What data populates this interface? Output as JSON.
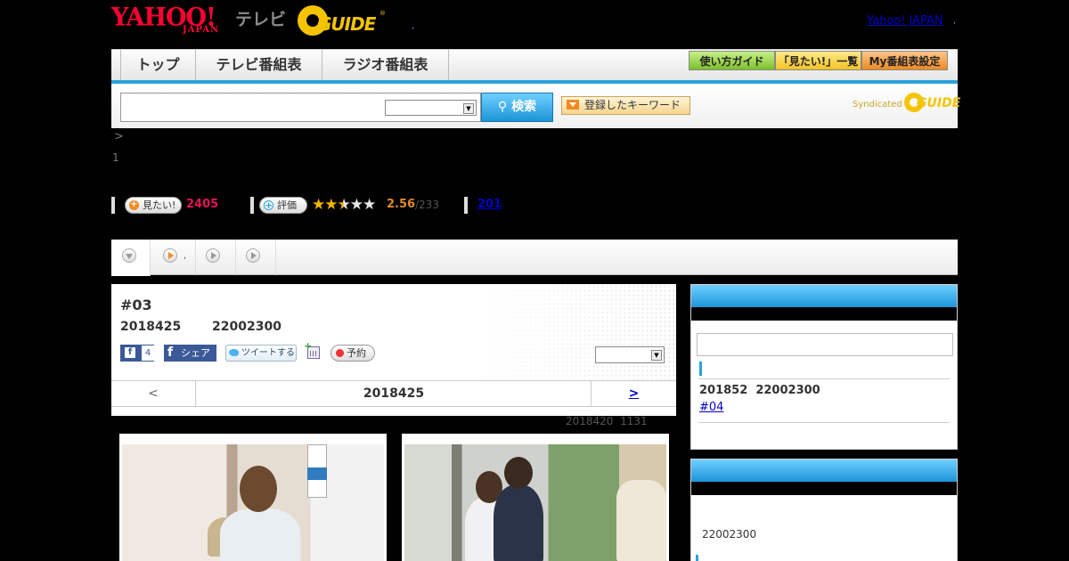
{
  "header": {
    "logo_yahoo_top": "YAHOO!",
    "logo_yahoo_bottom": "JAPAN",
    "logo_tv": "テレビ",
    "logo_gguide": "GUIDE",
    "logo_gguide_reg": "®",
    "separator": ",",
    "yahoo_japan_link": "Yahoo! JAPAN",
    "yahoo_japan_link_sep": ","
  },
  "nav": {
    "tabs": [
      {
        "label": "トップ"
      },
      {
        "label": "テレビ番組表"
      },
      {
        "label": "ラジオ番組表"
      }
    ],
    "buttons": {
      "guide": "使い方ガイド",
      "mitai_list": "「見たい!」一覧",
      "my_schedule": "My番組表設定"
    },
    "accent_color": "#2aa2dc"
  },
  "search": {
    "input_value": "",
    "select_value": "",
    "button_label": "検索",
    "keyword_button": "登録したキーワード",
    "syndicated_label": "Syndicated",
    "syndicated_logo": "GUIDE"
  },
  "breadcrumb": {
    "arrow": ">",
    "number": "1"
  },
  "stats": {
    "mitai_button": "見たい!",
    "mitai_count": "2405",
    "rating_button": "評価",
    "rating_score": "2.56",
    "rating_count": "/233",
    "rating_fraction": 0.512,
    "stars_on": "★★",
    "stars_half": "★",
    "stars_off": "★★",
    "review_link": "201",
    "highlight_color": "#e4145a"
  },
  "tabstrip": {
    "separator": ","
  },
  "episode": {
    "title": "#03",
    "date": "2018425",
    "time": "22002300",
    "fb_count": "4",
    "fb_share": "シェア",
    "tweet": "ツイートする",
    "reserve": "予約",
    "select_value": "",
    "nav_prev": "<",
    "nav_current": "2018425",
    "nav_next": ">",
    "updated_date": "2018420",
    "updated_time": "1131"
  },
  "sidebar": {
    "next_broadcast_date": "201852",
    "next_broadcast_time": "22002300",
    "next_episode_link": "#04",
    "section2_time": "22002300",
    "search_value": ""
  }
}
